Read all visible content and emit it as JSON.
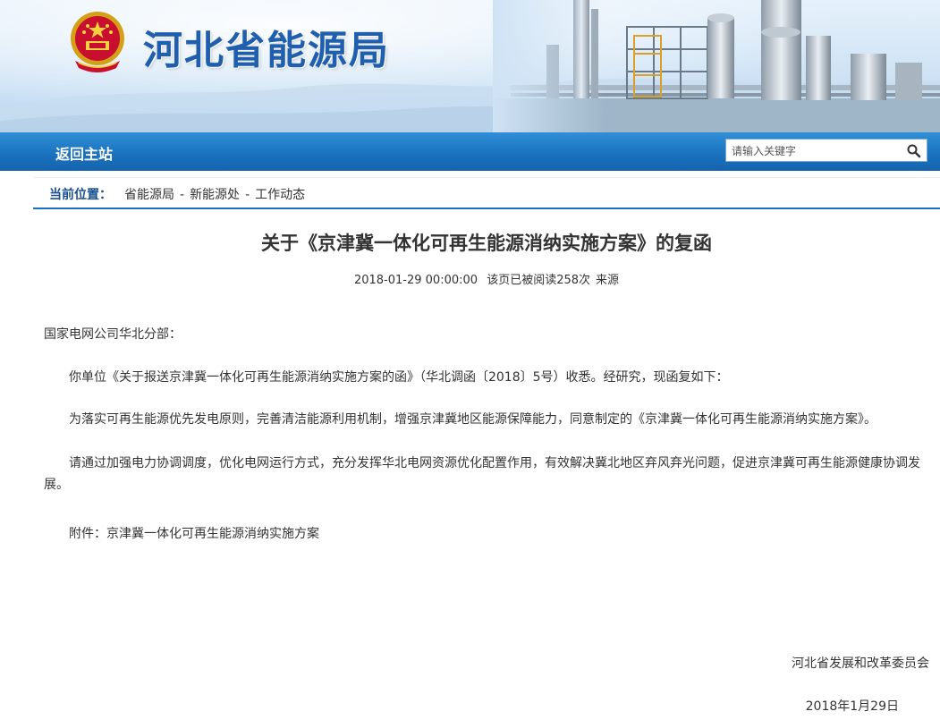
{
  "header": {
    "site_title": "河北省能源局"
  },
  "nav": {
    "home_label": "返回主站"
  },
  "search": {
    "placeholder": "请输入关键字",
    "icon": "search-icon"
  },
  "breadcrumb": {
    "label": "当前位置：",
    "items": [
      "省能源局",
      "新能源处",
      "工作动态"
    ],
    "separator": "-"
  },
  "article": {
    "title": "关于《京津冀一体化可再生能源消纳实施方案》的复函",
    "date": "2018-01-29 00:00:00",
    "views": "该页已被阅读258次",
    "source": "来源",
    "paragraphs": [
      "国家电网公司华北分部：",
      "你单位《关于报送京津冀一体化可再生能源消纳实施方案的函》（华北调函〔2018〕5号）收悉。经研究，现函复如下：",
      "为落实可再生能源优先发电原则，完善清洁能源利用机制，增强京津冀地区能源保障能力，同意制定的《京津冀一体化可再生能源消纳实施方案》。",
      "请通过加强电力协调调度，优化电网运行方式，充分发挥华北电网资源优化配置作用，有效解决冀北地区弃风弃光问题，促进京津冀可再生能源健康协调发展。",
      "附件：京津冀一体化可再生能源消纳实施方案"
    ],
    "signature": "河北省发展和改革委员会",
    "sign_date": "2018年1月29日"
  },
  "colors": {
    "brand_blue": "#1a71bd",
    "title_blue": "#1f5fae"
  }
}
